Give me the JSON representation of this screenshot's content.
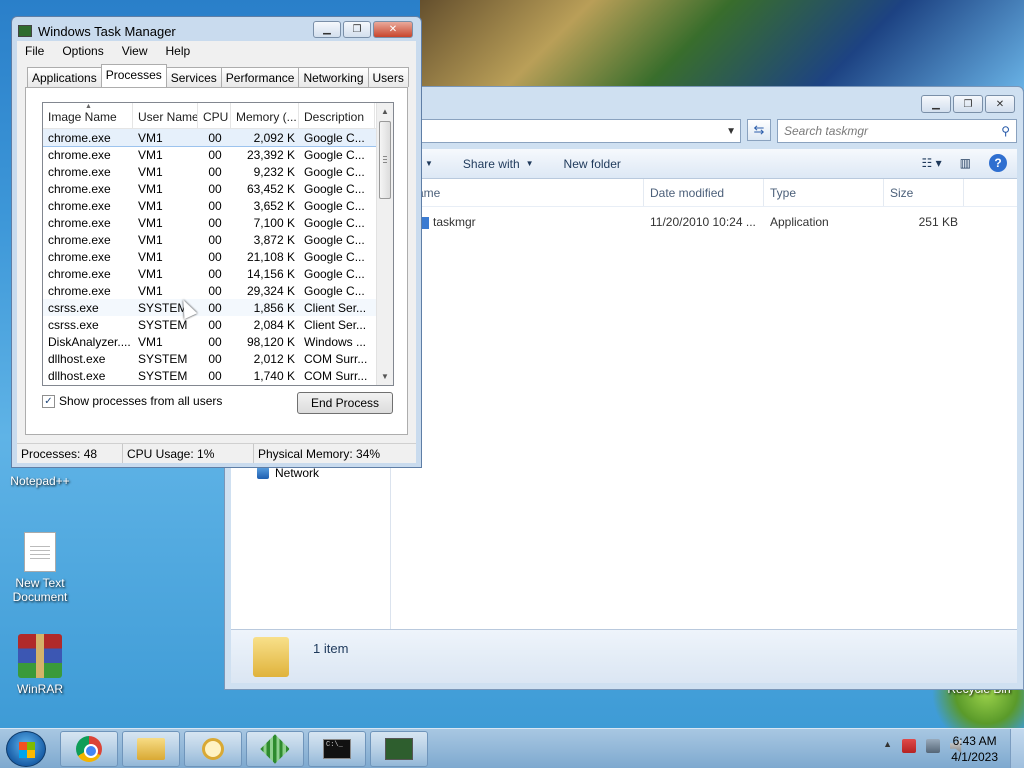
{
  "explorer": {
    "search_placeholder": "Search taskmgr",
    "toolbar": {
      "organize_partial": "y",
      "share_with": "Share with",
      "new_folder": "New folder"
    },
    "columns": {
      "name_partial": "ame",
      "date_modified": "Date modified",
      "type": "Type",
      "size": "Size"
    },
    "file": {
      "name": "taskmgr",
      "date": "11/20/2010 10:24 ...",
      "type": "Application",
      "size": "251 KB"
    },
    "nav_network": "Network",
    "item_count": "1 item"
  },
  "desktop_icons": {
    "notepad": "Notepad++",
    "new_text_doc": "New Text Document",
    "winrar": "WinRAR",
    "recycle_bin": "Recycle Bin"
  },
  "taskmgr": {
    "title": "Windows Task Manager",
    "menu": [
      "File",
      "Options",
      "View",
      "Help"
    ],
    "tabs": [
      "Applications",
      "Processes",
      "Services",
      "Performance",
      "Networking",
      "Users"
    ],
    "active_tab": "Processes",
    "columns": [
      "Image Name",
      "User Name",
      "CPU",
      "Memory (...",
      "Description"
    ],
    "rows": [
      [
        "chrome.exe",
        "VM1",
        "00",
        "2,092 K",
        "Google C..."
      ],
      [
        "chrome.exe",
        "VM1",
        "00",
        "23,392 K",
        "Google C..."
      ],
      [
        "chrome.exe",
        "VM1",
        "00",
        "9,232 K",
        "Google C..."
      ],
      [
        "chrome.exe",
        "VM1",
        "00",
        "63,452 K",
        "Google C..."
      ],
      [
        "chrome.exe",
        "VM1",
        "00",
        "3,652 K",
        "Google C..."
      ],
      [
        "chrome.exe",
        "VM1",
        "00",
        "7,100 K",
        "Google C..."
      ],
      [
        "chrome.exe",
        "VM1",
        "00",
        "3,872 K",
        "Google C..."
      ],
      [
        "chrome.exe",
        "VM1",
        "00",
        "21,108 K",
        "Google C..."
      ],
      [
        "chrome.exe",
        "VM1",
        "00",
        "14,156 K",
        "Google C..."
      ],
      [
        "chrome.exe",
        "VM1",
        "00",
        "29,324 K",
        "Google C..."
      ],
      [
        "csrss.exe",
        "SYSTEM",
        "00",
        "1,856 K",
        "Client Ser..."
      ],
      [
        "csrss.exe",
        "SYSTEM",
        "00",
        "2,084 K",
        "Client Ser..."
      ],
      [
        "DiskAnalyzer....",
        "VM1",
        "00",
        "98,120 K",
        "Windows ..."
      ],
      [
        "dllhost.exe",
        "SYSTEM",
        "00",
        "2,012 K",
        "COM Surr..."
      ],
      [
        "dllhost.exe",
        "SYSTEM",
        "00",
        "1,740 K",
        "COM Surr..."
      ]
    ],
    "show_all_users": "Show processes from all users",
    "end_process": "End Process",
    "status": {
      "processes": "Processes: 48",
      "cpu": "CPU Usage: 1%",
      "memory": "Physical Memory: 34%"
    }
  },
  "taskbar": {
    "time": "6:43 AM",
    "date": "4/1/2023",
    "cmd_text": "C:\\_"
  }
}
